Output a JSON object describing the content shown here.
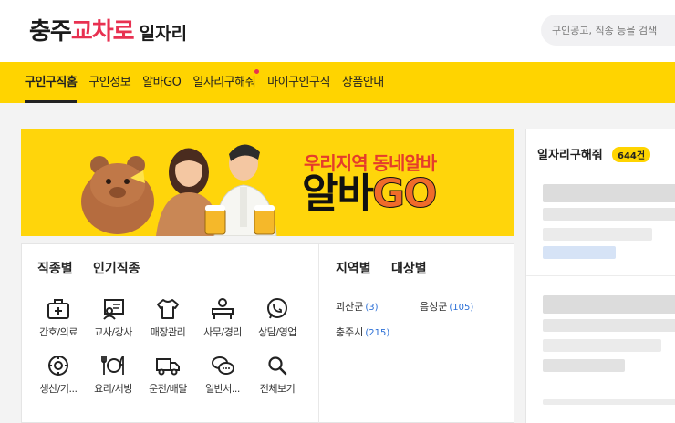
{
  "header": {
    "logo_part1": "충주",
    "logo_part2": "교차로",
    "logo_part3": "일자리",
    "search_placeholder": "구인공고, 직종 등을 검색"
  },
  "nav": {
    "items": [
      {
        "label": "구인구직홈",
        "active": true
      },
      {
        "label": "구인정보"
      },
      {
        "label": "알바GO"
      },
      {
        "label": "일자리구해줘",
        "badge": true
      },
      {
        "label": "마이구인구직"
      },
      {
        "label": "상품안내"
      }
    ]
  },
  "banner": {
    "tagline": "우리지역 동네알바",
    "title_part1": "알바",
    "title_part2": "GO"
  },
  "categories": {
    "tab_by_type": "직종별",
    "tab_popular": "인기직종",
    "items": [
      {
        "label": "간호/의료",
        "icon": "medical-kit-icon"
      },
      {
        "label": "교사/강사",
        "icon": "teacher-board-icon"
      },
      {
        "label": "매장관리",
        "icon": "shirt-icon"
      },
      {
        "label": "사무/경리",
        "icon": "office-worker-icon"
      },
      {
        "label": "상담/영업",
        "icon": "phone-chat-icon"
      },
      {
        "label": "생산/기...",
        "icon": "gear-icon"
      },
      {
        "label": "요리/서빙",
        "icon": "dining-icon"
      },
      {
        "label": "운전/배달",
        "icon": "truck-icon"
      },
      {
        "label": "일반서...",
        "icon": "chat-bubbles-icon"
      },
      {
        "label": "전체보기",
        "icon": "search-icon"
      }
    ]
  },
  "regions": {
    "tab_region": "지역별",
    "tab_target": "대상별",
    "items": [
      {
        "name": "괴산군",
        "count": "(3)"
      },
      {
        "name": "음성군",
        "count": "(105)"
      },
      {
        "name": "충주시",
        "count": "(215)"
      }
    ]
  },
  "aside": {
    "title": "일자리구해줘",
    "count": "644건"
  },
  "colors": {
    "accent_yellow": "#ffd400",
    "brand_red": "#e83151",
    "link_blue": "#2b6fd6"
  }
}
